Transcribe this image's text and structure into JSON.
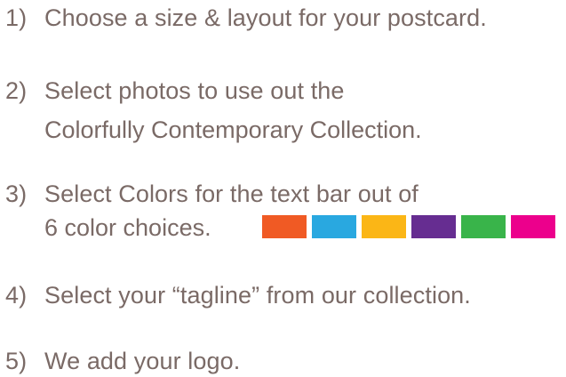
{
  "steps": [
    {
      "number": "1)",
      "lines": [
        "Choose a size & layout for your postcard."
      ]
    },
    {
      "number": "2)",
      "lines": [
        "Select photos to use out the",
        "Colorfully Contemporary Collection."
      ]
    },
    {
      "number": "3)",
      "lines": [
        "Select Colors for the text bar out of",
        "6 color choices."
      ]
    },
    {
      "number": "4)",
      "lines": [
        "Select your “tagline” from our collection."
      ]
    },
    {
      "number": "5)",
      "lines": [
        "We add your logo."
      ]
    }
  ],
  "color_choices": [
    {
      "name": "orange",
      "hex": "#f05a24"
    },
    {
      "name": "sky-blue",
      "hex": "#29a8e0"
    },
    {
      "name": "yellow",
      "hex": "#fbb616"
    },
    {
      "name": "purple",
      "hex": "#662d91"
    },
    {
      "name": "green",
      "hex": "#39b44a"
    },
    {
      "name": "magenta",
      "hex": "#ec008c"
    }
  ]
}
